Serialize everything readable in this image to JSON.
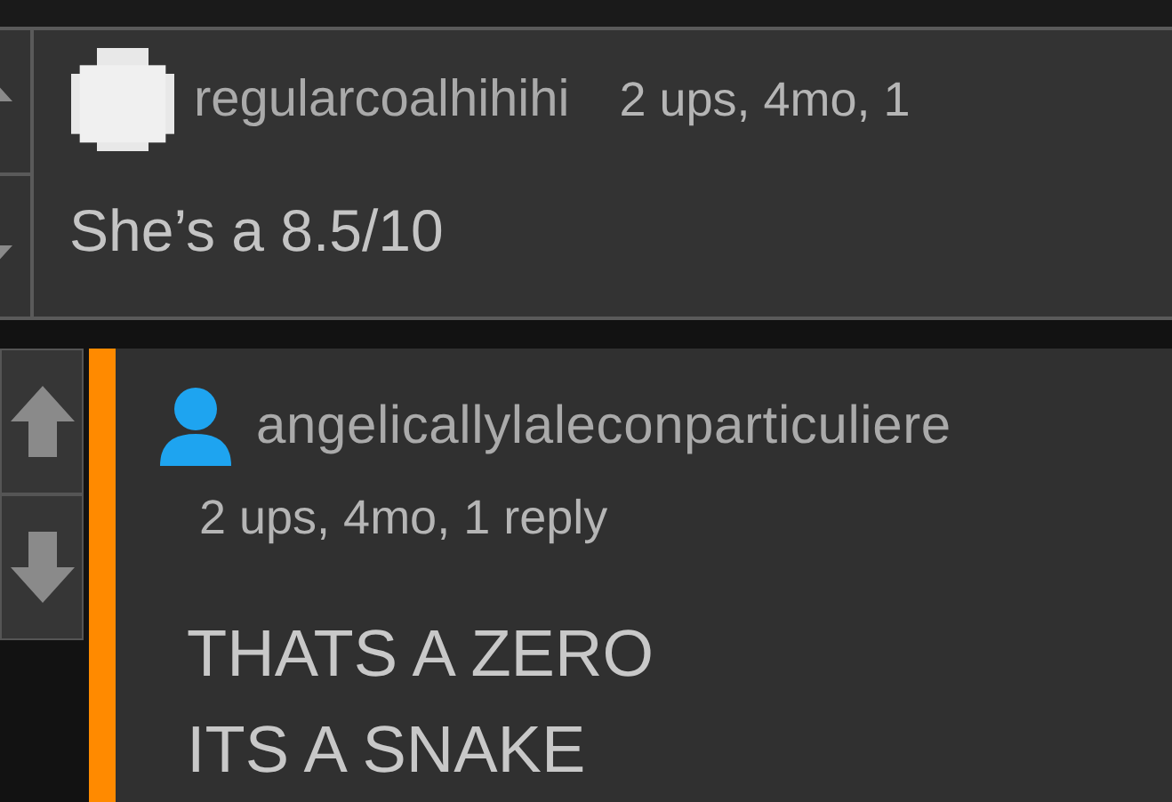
{
  "comments": [
    {
      "kind": "compact",
      "avatar": {
        "kind": "pixel"
      },
      "username": "regularcoalhihihi",
      "meta": "2 ups, 4mo, 1",
      "text_lines": [
        "She’s a 8.5/10"
      ],
      "highlighted": false
    },
    {
      "kind": "full",
      "avatar": {
        "kind": "person"
      },
      "username": "angelicallylaleconparticuliere",
      "meta": "2 ups, 4mo, 1 reply",
      "text_lines": [
        "THATS A ZERO",
        "ITS A SNAKE"
      ],
      "highlighted": true
    }
  ]
}
